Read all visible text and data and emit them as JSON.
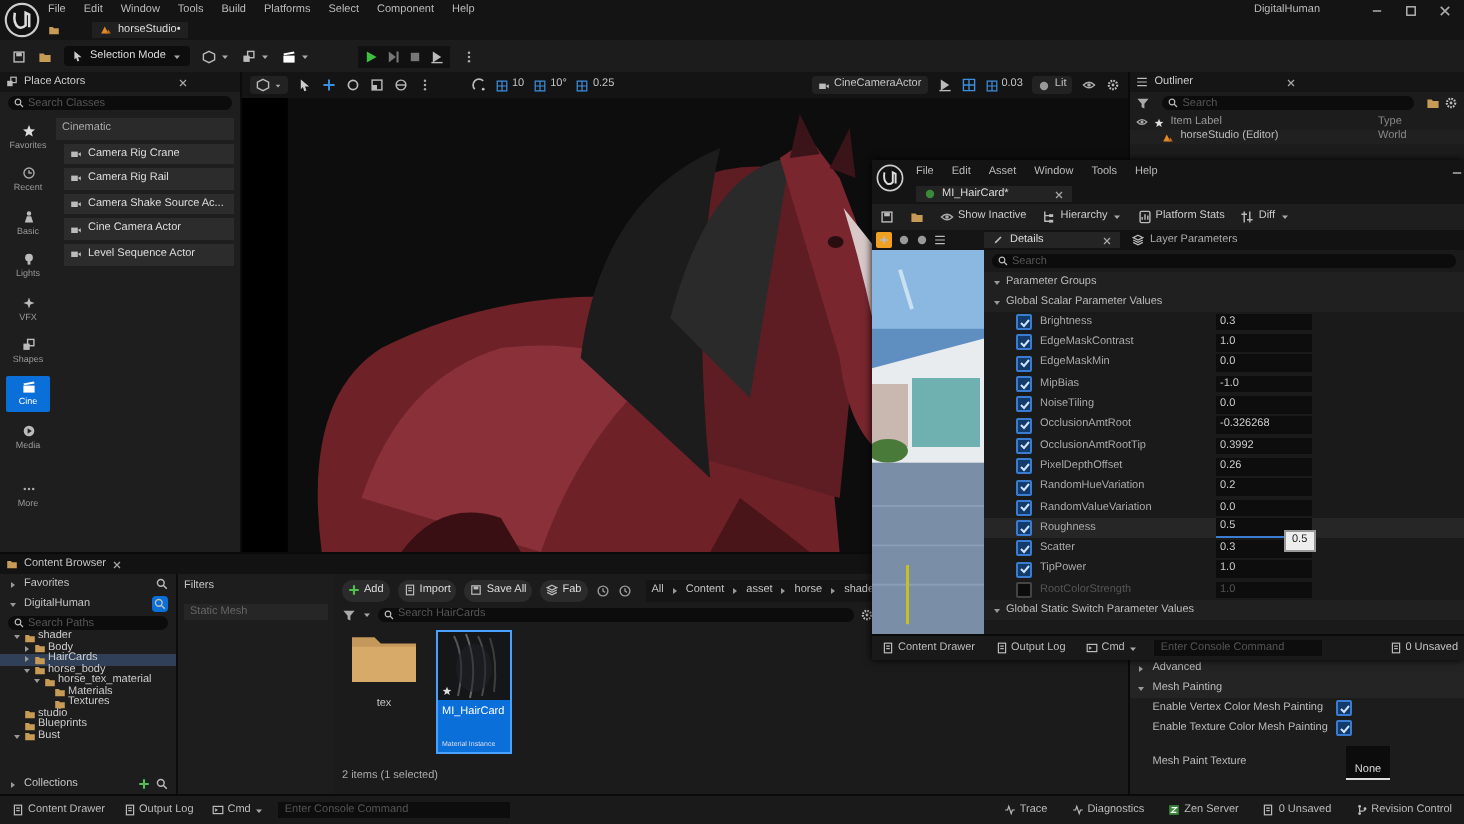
{
  "window": {
    "title": "DigitalHuman",
    "menu": [
      "File",
      "Edit",
      "Window",
      "Tools",
      "Build",
      "Platforms",
      "Select",
      "Component",
      "Help"
    ],
    "document_tab": "horseStudio•"
  },
  "toolbar": {
    "mode": "Selection Mode"
  },
  "place_actors": {
    "title": "Place Actors",
    "search": {
      "placeholder": "Search Classes"
    },
    "categories": [
      {
        "label": "Favorites",
        "selected": false
      },
      {
        "label": "Recent",
        "selected": false
      },
      {
        "label": "Basic",
        "selected": false
      },
      {
        "label": "Lights",
        "selected": false
      },
      {
        "label": "VFX",
        "selected": false
      },
      {
        "label": "Shapes",
        "selected": false
      },
      {
        "label": "Cine",
        "selected": true
      },
      {
        "label": "Media",
        "selected": false
      },
      {
        "label": "More",
        "selected": false
      }
    ],
    "group": "Cinematic",
    "items": [
      "Camera Rig Crane",
      "Camera Rig Rail",
      "Camera Shake Source Ac...",
      "Cine Camera Actor",
      "Level Sequence Actor"
    ]
  },
  "viewport": {
    "snaps": [
      "10",
      "10°",
      "0.25"
    ],
    "camera": "CineCameraActor",
    "speed": "0.03",
    "view_mode": "Lit"
  },
  "outliner": {
    "title": "Outliner",
    "search": {
      "placeholder": "Search"
    },
    "columns": [
      "Item Label",
      "Type"
    ],
    "rows": [
      {
        "label": "horseStudio (Editor)",
        "type": "World"
      }
    ]
  },
  "level_details": {
    "sections": [
      {
        "kind": "header",
        "label": "Advanced",
        "expanded": false
      },
      {
        "kind": "header",
        "label": "Mesh Painting",
        "expanded": true
      },
      {
        "kind": "check",
        "label": "Enable Vertex Color Mesh Painting",
        "checked": true
      },
      {
        "kind": "check",
        "label": "Enable Texture Color Mesh Painting",
        "checked": true
      },
      {
        "kind": "texture",
        "label": "Mesh Paint Texture",
        "value": "None"
      }
    ]
  },
  "content_browser": {
    "title": "Content Browser",
    "favorites": "Favorites",
    "root": "DigitalHuman",
    "search": {
      "placeholder": "Search Paths"
    },
    "tree": [
      {
        "label": "shader",
        "expanded": true,
        "selected": false,
        "children": [
          {
            "label": "Body",
            "expanded": false,
            "selected": false
          },
          {
            "label": "HairCards",
            "expanded": false,
            "selected": true
          },
          {
            "label": "horse_body",
            "expanded": true,
            "selected": false,
            "children": [
              {
                "label": "horse_tex_material",
                "expanded": true,
                "selected": false,
                "children": [
                  {
                    "label": "Materials",
                    "selected": false
                  },
                  {
                    "label": "Textures",
                    "selected": false
                  }
                ]
              }
            ]
          }
        ]
      },
      {
        "label": "studio",
        "selected": false
      },
      {
        "label": "Blueprints",
        "selected": false
      },
      {
        "label": "Bust",
        "expanded": true,
        "selected": false
      }
    ],
    "collections": "Collections",
    "filters": {
      "title": "Filters",
      "placeholder": "Static Mesh"
    },
    "actions": [
      "Add",
      "Import",
      "Save All",
      "Fab"
    ],
    "breadcrumb": [
      "All",
      "Content",
      "asset",
      "horse",
      "shade"
    ],
    "asset_search": {
      "placeholder": "Search HairCards"
    },
    "assets": [
      {
        "kind": "folder",
        "label": "tex",
        "selected": false
      },
      {
        "kind": "material",
        "label": "MI_HairCard",
        "type": "Material Instance",
        "selected": true
      }
    ],
    "footer": "2 items (1 selected)"
  },
  "status_bar": {
    "left": [
      "Content Drawer",
      "Output Log",
      "Cmd"
    ],
    "console": {
      "placeholder": "Enter Console Command"
    },
    "right": [
      "Trace",
      "Diagnostics",
      "Zen Server",
      "0 Unsaved",
      "Revision Control"
    ]
  },
  "material_editor": {
    "menu": [
      "File",
      "Edit",
      "Asset",
      "Window",
      "Tools",
      "Help"
    ],
    "tab": "MI_HairCard*",
    "toolbar": [
      "Show Inactive",
      "Hierarchy",
      "Platform Stats",
      "Diff"
    ],
    "tabs": [
      {
        "label": "Details",
        "selected": true
      },
      {
        "label": "Layer Parameters",
        "selected": false
      }
    ],
    "search": {
      "placeholder": "Search"
    },
    "groups": "Parameter Groups",
    "scalar_header": "Global Scalar Parameter Values",
    "params": [
      {
        "name": "Brightness",
        "value": "0.3",
        "checked": true,
        "hovered": false
      },
      {
        "name": "EdgeMaskContrast",
        "value": "1.0",
        "checked": true,
        "hovered": false
      },
      {
        "name": "EdgeMaskMin",
        "value": "0.0",
        "checked": true,
        "hovered": false
      },
      {
        "name": "MipBias",
        "value": "-1.0",
        "checked": true,
        "hovered": false
      },
      {
        "name": "NoiseTiling",
        "value": "0.0",
        "checked": true,
        "hovered": false
      },
      {
        "name": "OcclusionAmtRoot",
        "value": "-0.326268",
        "checked": true,
        "hovered": false
      },
      {
        "name": "OcclusionAmtRootTip",
        "value": "0.3992",
        "checked": true,
        "hovered": false
      },
      {
        "name": "PixelDepthOffset",
        "value": "0.26",
        "checked": true,
        "hovered": false
      },
      {
        "name": "RandomHueVariation",
        "value": "0.2",
        "checked": true,
        "hovered": false
      },
      {
        "name": "RandomValueVariation",
        "value": "0.0",
        "checked": true,
        "hovered": false
      },
      {
        "name": "Roughness",
        "value": "0.5",
        "checked": true,
        "hovered": true
      },
      {
        "name": "Scatter",
        "value": "0.3",
        "checked": true,
        "hovered": false
      },
      {
        "name": "TipPower",
        "value": "1.0",
        "checked": true,
        "hovered": false
      },
      {
        "name": "RootColorStrength",
        "value": "1.0",
        "checked": false,
        "hovered": false
      }
    ],
    "tooltip": "0.5",
    "switch_header": "Global Static Switch Parameter Values",
    "bottom": [
      "Content Drawer",
      "Output Log",
      "Cmd"
    ],
    "console": {
      "placeholder": "Enter Console Command"
    },
    "unsaved": "0 Unsaved"
  }
}
